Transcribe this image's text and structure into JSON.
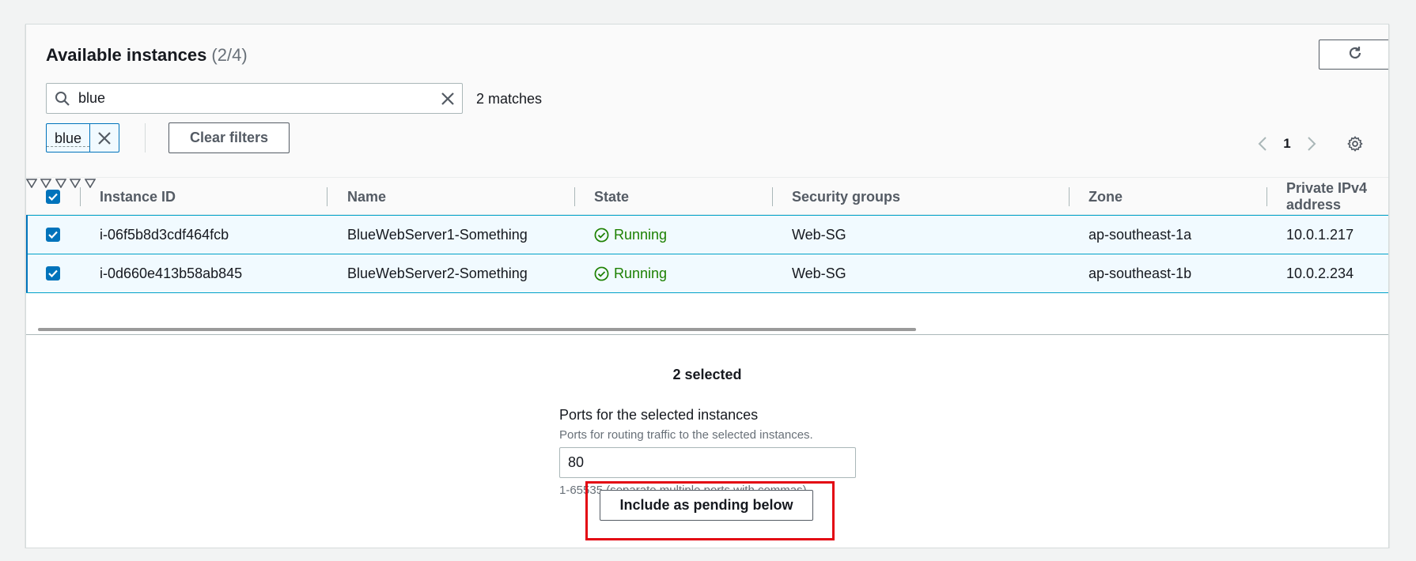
{
  "panel": {
    "title": "Available instances",
    "count": "(2/4)"
  },
  "search": {
    "value": "blue",
    "matches": "2 matches"
  },
  "filter_token": {
    "label": "blue"
  },
  "clear_filters_label": "Clear filters",
  "pagination": {
    "current_page": "1"
  },
  "table": {
    "columns": [
      "Instance ID",
      "Name",
      "State",
      "Security groups",
      "Zone",
      "Private IPv4 address"
    ],
    "rows": [
      {
        "instance_id": "i-06f5b8d3cdf464fcb",
        "name": "BlueWebServer1-Something",
        "state": "Running",
        "security_groups": "Web-SG",
        "zone": "ap-southeast-1a",
        "ipv4": "10.0.1.217",
        "selected": true
      },
      {
        "instance_id": "i-0d660e413b58ab845",
        "name": "BlueWebServer2-Something",
        "state": "Running",
        "security_groups": "Web-SG",
        "zone": "ap-southeast-1b",
        "ipv4": "10.0.2.234",
        "selected": true
      }
    ]
  },
  "selection": {
    "summary": "2 selected"
  },
  "ports": {
    "label": "Ports for the selected instances",
    "description": "Ports for routing traffic to the selected instances.",
    "value": "80",
    "hint": "1-65535 (separate multiple ports with commas)"
  },
  "include_button_label": "Include as pending below",
  "colors": {
    "primary": "#0073bb",
    "running": "#1d8102",
    "highlight": "#e30613"
  }
}
